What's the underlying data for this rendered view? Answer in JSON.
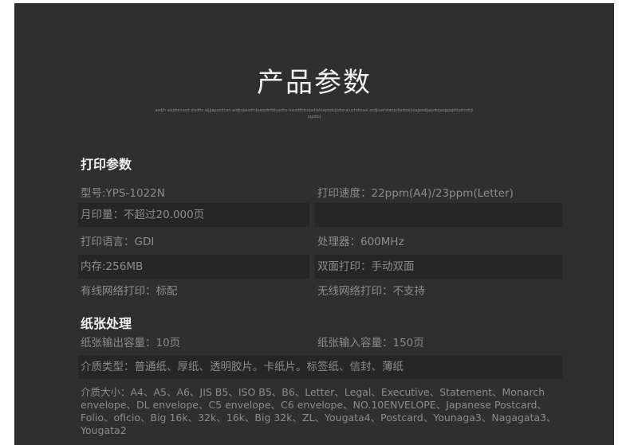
{
  "title": "产品参数",
  "subtitle": "asdjh aisjdoinasd aisdhs aijjjapocdcan aidjiojaisdinlaaojdnfdiusohu nsuidfhicnjadiahiapodcjjidonaiushduiasi asdjiuahdanpdiadsoijoiajpodjjajsdojaojpjojdhjakodcjijapdsij",
  "print_section": {
    "heading": "打印参数",
    "rows": [
      {
        "left": "型号:YPS-1022N",
        "right": "打印速度：22ppm(A4)/23ppm(Letter)"
      },
      {
        "left": "月印量：不超过20.000页",
        "right": ""
      },
      {
        "left": "打印语言：GDI",
        "right": "处理器：600MHz"
      },
      {
        "left": "内存:256MB",
        "right": "双面打印：手动双面"
      },
      {
        "left": "有线网络打印：标配",
        "right": "无线网络打印：不支持"
      }
    ]
  },
  "paper_section": {
    "heading": "纸张处理",
    "output_capacity": "纸张输出容量：10页",
    "input_capacity": "纸张输入容量：150页",
    "media_type": "介质类型：普通纸、厚纸、透明胶片。卡纸片。标签纸、信封、薄纸",
    "media_size": "介质大小：A4、A5、A6、JIS B5、ISO B5、B6、Letter、Legal、Executive、Statement、Monarch envelope、DL envelope、C5 envelope、C6 envelope、NO.10ENVELOPE、Japanese Postcard、Folio、oficio、Big 16k、32k、16k、Big 32k、ZL、Yougata4、Postcard、Younaga3、Nagagata3、Yougata2"
  }
}
